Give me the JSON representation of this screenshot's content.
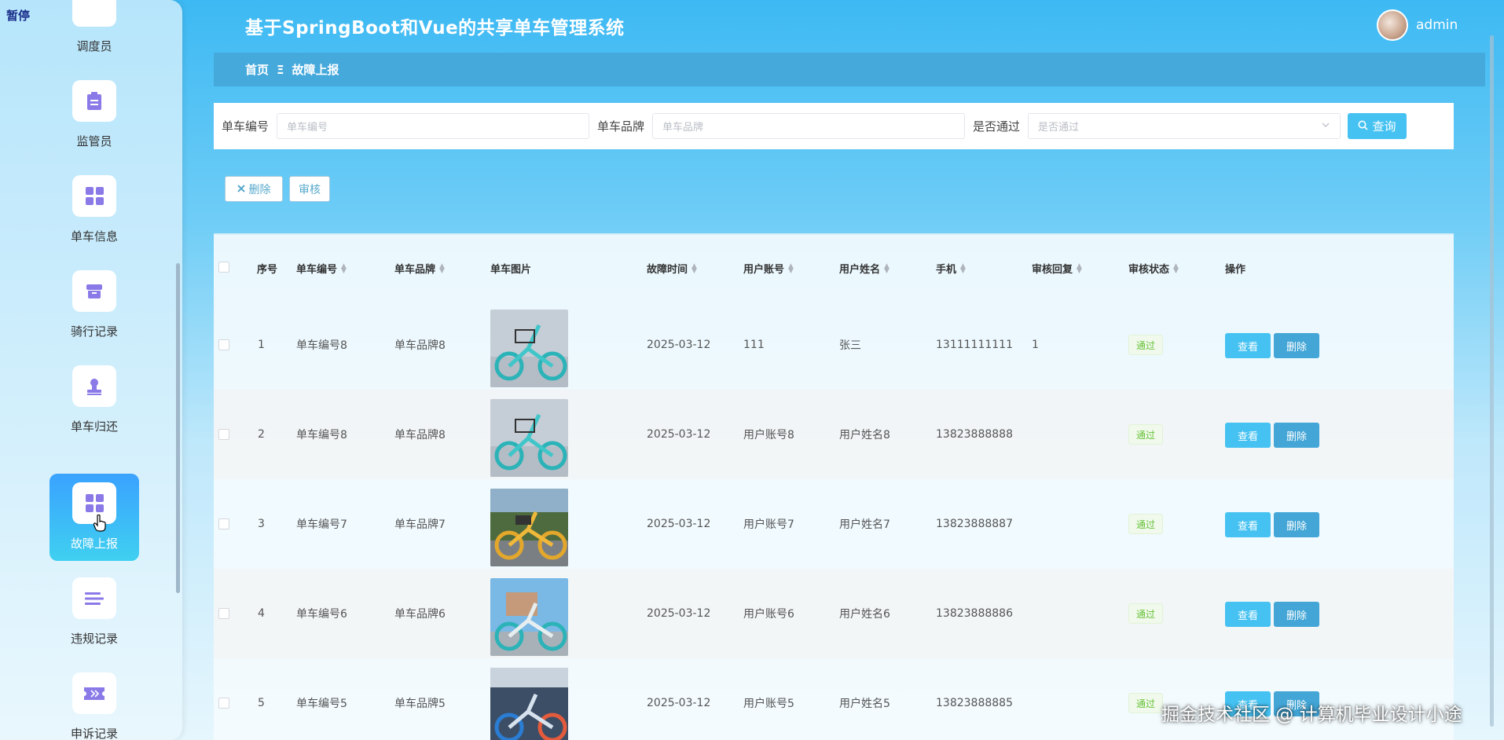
{
  "overlay_label": "暂停",
  "header": {
    "title": "基于SpringBoot和Vue的共享单车管理系统",
    "username": "admin"
  },
  "breadcrumb": {
    "home": "首页",
    "separator": "Ξ",
    "current": "故障上报"
  },
  "sidebar": {
    "items": [
      {
        "label": "调度员",
        "icon": "clipboard-icon"
      },
      {
        "label": "监管员",
        "icon": "clipboard-icon"
      },
      {
        "label": "单车信息",
        "icon": "grid-icon"
      },
      {
        "label": "骑行记录",
        "icon": "box-icon"
      },
      {
        "label": "单车归还",
        "icon": "stamp-icon"
      },
      {
        "label": "故障上报",
        "icon": "grid-icon",
        "active": true
      },
      {
        "label": "违规记录",
        "icon": "list-icon"
      },
      {
        "label": "申诉记录",
        "icon": "ticket-icon"
      }
    ]
  },
  "search": {
    "bike_no_label": "单车编号",
    "bike_no_placeholder": "单车编号",
    "brand_label": "单车品牌",
    "brand_placeholder": "单车品牌",
    "approved_label": "是否通过",
    "approved_placeholder": "是否通过",
    "query_button": "查询"
  },
  "actions": {
    "delete_button": "删除",
    "review_button": "审核"
  },
  "table": {
    "headers": {
      "index": "序号",
      "bike_no": "单车编号",
      "brand": "单车品牌",
      "image": "单车图片",
      "fault_time": "故障时间",
      "user_account": "用户账号",
      "user_name": "用户姓名",
      "phone": "手机",
      "review_reply": "审核回复",
      "review_status": "审核状态",
      "operations": "操作"
    },
    "rows": [
      {
        "index": "1",
        "bike_no": "单车编号8",
        "brand": "单车品牌8",
        "fault_time": "2025-03-12",
        "user_account": "111",
        "user_name": "张三",
        "phone": "13111111111",
        "review_reply": "1",
        "review_status": "通过",
        "view": "查看",
        "delete": "删除"
      },
      {
        "index": "2",
        "bike_no": "单车编号8",
        "brand": "单车品牌8",
        "fault_time": "2025-03-12",
        "user_account": "用户账号8",
        "user_name": "用户姓名8",
        "phone": "13823888888",
        "review_reply": "",
        "review_status": "通过",
        "view": "查看",
        "delete": "删除"
      },
      {
        "index": "3",
        "bike_no": "单车编号7",
        "brand": "单车品牌7",
        "fault_time": "2025-03-12",
        "user_account": "用户账号7",
        "user_name": "用户姓名7",
        "phone": "13823888887",
        "review_reply": "",
        "review_status": "通过",
        "view": "查看",
        "delete": "删除"
      },
      {
        "index": "4",
        "bike_no": "单车编号6",
        "brand": "单车品牌6",
        "fault_time": "2025-03-12",
        "user_account": "用户账号6",
        "user_name": "用户姓名6",
        "phone": "13823888886",
        "review_reply": "",
        "review_status": "通过",
        "view": "查看",
        "delete": "删除"
      },
      {
        "index": "5",
        "bike_no": "单车编号5",
        "brand": "单车品牌5",
        "fault_time": "2025-03-12",
        "user_account": "用户账号5",
        "user_name": "用户姓名5",
        "phone": "13823888885",
        "review_reply": "",
        "review_status": "通过",
        "view": "查看",
        "delete": "删除"
      }
    ]
  },
  "watermark": "掘金技术社区 @ 计算机毕业设计小途"
}
